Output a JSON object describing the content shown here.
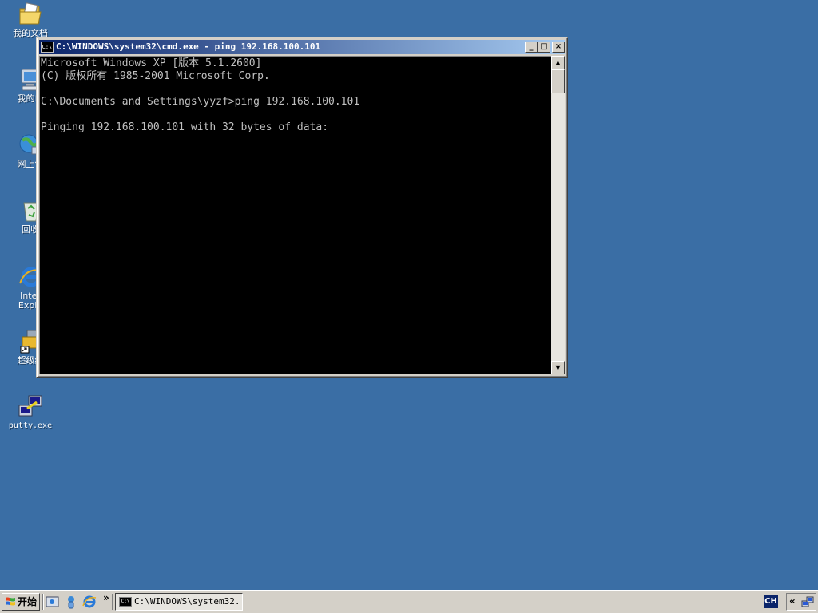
{
  "desktop": {
    "icons": [
      {
        "label": "我的文档",
        "icon": "my-documents-icon"
      },
      {
        "label": "我的电",
        "icon": "my-computer-icon"
      },
      {
        "label": "网上邻",
        "icon": "network-places-icon"
      },
      {
        "label": "回收",
        "icon": "recycle-bin-icon"
      },
      {
        "label": "Inter",
        "label2": "Explo",
        "icon": "internet-explorer-icon"
      },
      {
        "label": "超级终",
        "icon": "hyperterminal-icon"
      },
      {
        "label": "putty.exe",
        "icon": "putty-icon"
      }
    ],
    "background_color": "#3a6ea5"
  },
  "cmd_window": {
    "title": "C:\\WINDOWS\\system32\\cmd.exe - ping 192.168.100.101",
    "icon_text": "C:\\",
    "minimize_glyph": "_",
    "maximize_glyph": "□",
    "close_glyph": "×",
    "scroll_up_glyph": "▲",
    "scroll_down_glyph": "▼",
    "lines": [
      "Microsoft Windows XP [版本 5.1.2600]",
      "(C) 版权所有 1985-2001 Microsoft Corp.",
      "",
      "C:\\Documents and Settings\\yyzf>ping 192.168.100.101",
      "",
      "Pinging 192.168.100.101 with 32 bytes of data:"
    ]
  },
  "taskbar": {
    "start_label": "开始",
    "quick_launch_more": "»",
    "task_button_label": "C:\\WINDOWS\\system32...",
    "task_icon_text": "C:\\",
    "ime_label": "CH",
    "tray_chevron": "«"
  }
}
